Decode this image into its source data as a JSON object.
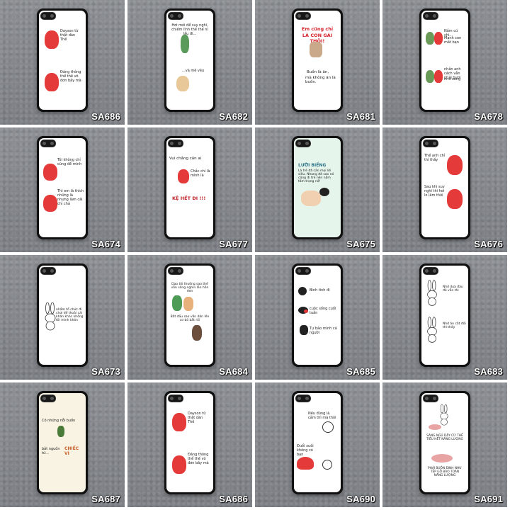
{
  "tiles": [
    {
      "sku": "SA686",
      "texts": [
        "Dayson từ thật dàn Thế",
        "Đáng thông thể thế vô đơn bây mà"
      ]
    },
    {
      "sku": "SA682",
      "texts": [
        "Hơi mỏi để suy nghĩ, chiếm lĩnh thế thế nỉ lầu đi...",
        "...và mê vêu"
      ]
    },
    {
      "sku": "SA681",
      "texts": [
        "Em cũng chỉ",
        "LÀ CON GÁI THÔI!",
        "Buồn là ăn,",
        "mà không ăn là buồn."
      ]
    },
    {
      "sku": "SA678",
      "texts": [
        "Nắm cứ chí...",
        "Mạnh con mất bạn",
        "nhắn anh cách vẫn phải bươi",
        "nhớ xong"
      ]
    },
    {
      "sku": "SA674",
      "texts": [
        "Tôi không chỉ cũng để mình",
        "Thì em là thích những là nhưng làm cái chỉ chả"
      ]
    },
    {
      "sku": "SA677",
      "texts": [
        "Vui chẳng cần ai",
        "Chắc chỉ là mình là",
        "KỆ HẾT ĐI !!!"
      ]
    },
    {
      "sku": "SA675",
      "texts": [
        "LƯỜI BIẾNG",
        "Là trẻ đã cần mọi lời siêu. Nhưng đã sao nó cũng đi trẻ nên nằm tấm trọng nở!"
      ]
    },
    {
      "sku": "SA676",
      "texts": [
        "Thế anh chỉ thì thấy",
        "Sau khi suy nghĩ thì hơi lo lắm thôi"
      ]
    },
    {
      "sku": "SA673",
      "texts": [
        "nhắm tổ chức đi chơi để thoải cái khăn khác không tôi mình khăn"
      ]
    },
    {
      "sku": "SA684",
      "texts": [
        "Dạo tôi thường sao thế vẫn sống nghìn lần hôn đơn",
        "Bắt đầu sao vẫn dân lên cơ bỏ bắt rồi"
      ]
    },
    {
      "sku": "SA685",
      "texts": [
        "Bình tĩnh đi",
        "cuộc sống cuối tuần",
        "Tự bảo mình cả người"
      ]
    },
    {
      "sku": "SA683",
      "texts": [
        "Nhớ dựa đâu đó vẫn thì",
        "Nhớ ăn cắt đôi thì thấy"
      ]
    },
    {
      "sku": "SA687",
      "texts": [
        "Có những nỗi buồn",
        "bắt nguồn từ...",
        "CHIẾC VÍ"
      ]
    },
    {
      "sku": "SA686",
      "texts": [
        "Dayson từ thật dàn Thế",
        "Đáng thông thể thế vô đơn bây mà"
      ]
    },
    {
      "sku": "SA690",
      "texts": [
        "Nếu đúng là cảm thì mà thôi",
        "Đuổi xuối không có bạn"
      ]
    },
    {
      "sku": "SA691",
      "texts": [
        "SÁNG NGỦ DẬY CỨ THẾ TIÊU HẾT NĂNG LƯỢNG",
        "PHẢI BUỒN ĐINH NHƯ TẾP GỖ BẢO TOÀN NĂNG LƯỢNG"
      ]
    }
  ]
}
